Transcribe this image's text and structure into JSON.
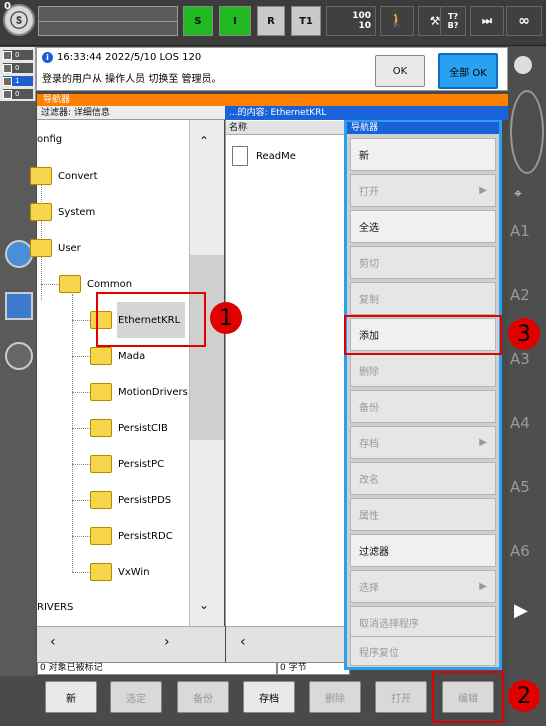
{
  "topbar": {
    "program_number": "0",
    "s_label": "S",
    "i_label": "I",
    "r_label": "R",
    "t1_label": "T1",
    "speed_top": "100",
    "speed_bottom": "10",
    "t_label": "T?",
    "b_label": "B?",
    "infinity": "∞"
  },
  "lights": [
    "0",
    "0",
    "1",
    "0"
  ],
  "message": {
    "timestamp": "16:33:44 2022/5/10 LOS 120",
    "text": "登录的用户从 操作人员 切换至 管理员。",
    "ok_label": "OK",
    "ok_all_label": "全部 OK"
  },
  "right_axes": [
    "A1",
    "A2",
    "A3",
    "A4",
    "A5",
    "A6"
  ],
  "navigator": {
    "title": "导航器",
    "filter_label": "过滤器: 详细信息",
    "content_label": "...的内容: EthernetKRL",
    "column_name": "名称",
    "tree": {
      "config": "onfig",
      "convert": "Convert",
      "system": "System",
      "user": "User",
      "common": "Common",
      "ethernetkrl": "EthernetKRL",
      "mada": "Mada",
      "motiondrivers": "MotionDrivers",
      "persistcib": "PersistCIB",
      "persistpc": "PersistPC",
      "persistpds": "PersistPDS",
      "persistrdc": "PersistRDC",
      "vxwin": "VxWin",
      "drivers": "RIVERS"
    },
    "file_readme": "ReadMe",
    "status_marked": "0 对象已被标记",
    "status_bytes": "0 字节"
  },
  "popup": {
    "title": "导航器",
    "items": [
      {
        "label": "新",
        "enabled": true
      },
      {
        "label": "打开",
        "enabled": false,
        "submenu": true
      },
      {
        "label": "全选",
        "enabled": true
      },
      {
        "label": "剪切",
        "enabled": false
      },
      {
        "label": "复制",
        "enabled": false
      },
      {
        "label": "添加",
        "enabled": true
      },
      {
        "label": "删除",
        "enabled": false
      },
      {
        "label": "备份",
        "enabled": false
      },
      {
        "label": "存档",
        "enabled": false,
        "submenu": true
      },
      {
        "label": "改名",
        "enabled": false
      },
      {
        "label": "属性",
        "enabled": false
      },
      {
        "label": "过滤器",
        "enabled": true
      },
      {
        "label": "选择",
        "enabled": false,
        "submenu": true
      },
      {
        "label": "取消选择程序",
        "enabled": false
      },
      {
        "label": "程序复位",
        "enabled": false
      }
    ]
  },
  "bottombar": {
    "new": "新",
    "select": "选定",
    "backup": "备份",
    "archive": "存档",
    "delete": "删除",
    "open": "打开",
    "edit": "编辑"
  },
  "annotations": {
    "one": "1",
    "two": "2",
    "three": "3"
  },
  "colors": {
    "accent_orange": "#ff8000",
    "accent_blue": "#2aa1f0",
    "status_green": "#22b822",
    "annotation_red": "#e00000"
  }
}
